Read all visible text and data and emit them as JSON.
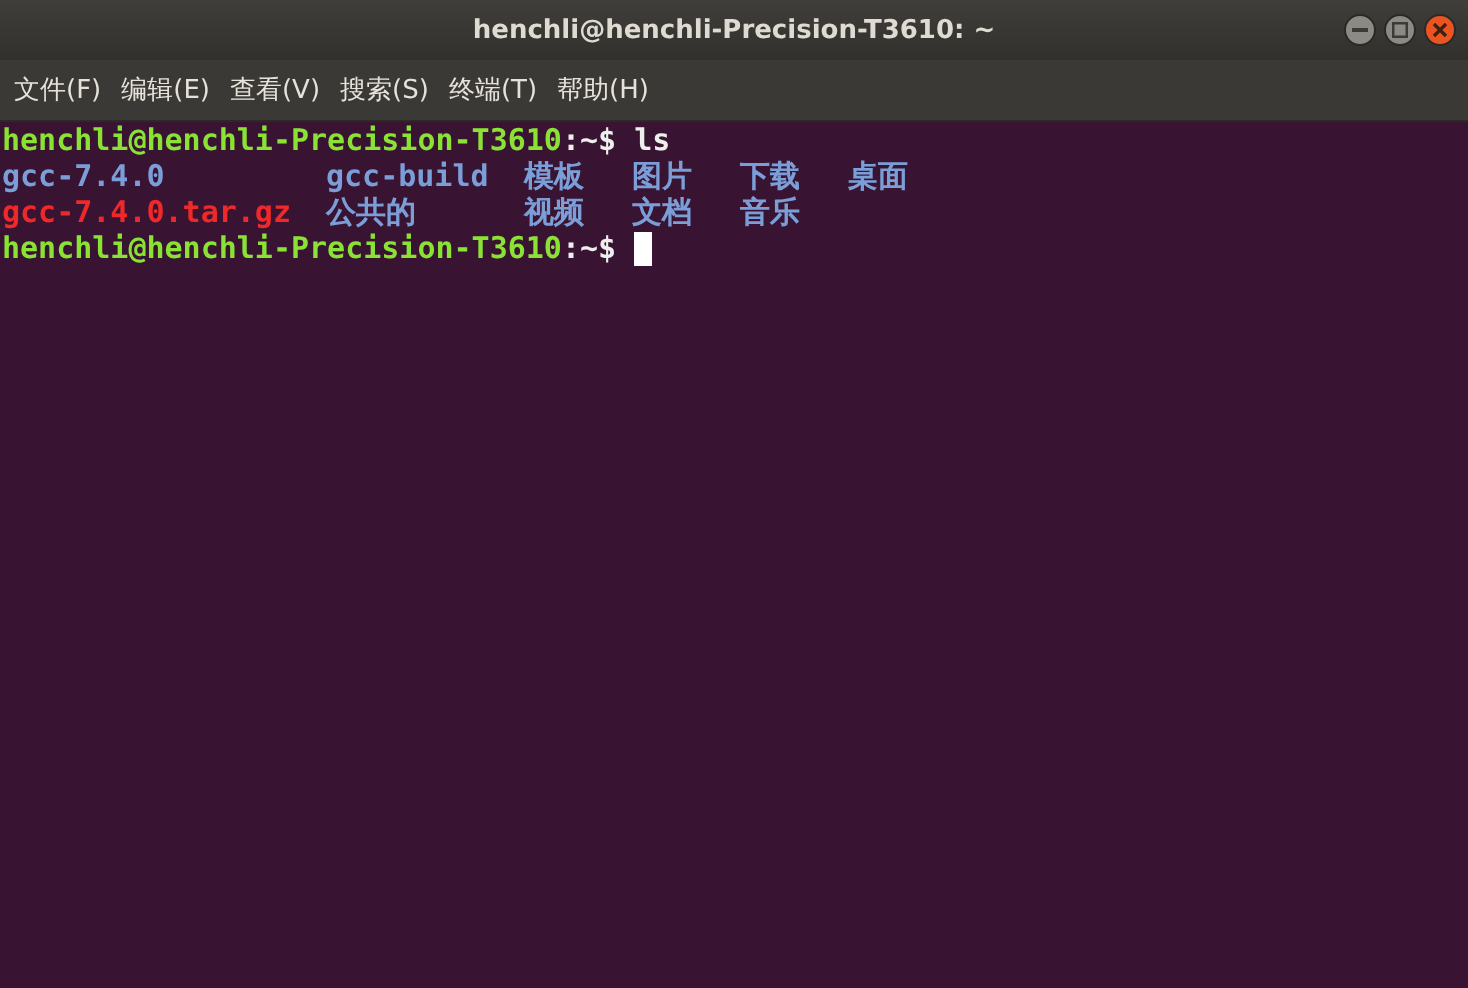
{
  "window": {
    "title": "henchli@henchli-Precision-T3610: ~"
  },
  "menu": [
    {
      "label": "文件(F)"
    },
    {
      "label": "编辑(E)"
    },
    {
      "label": "查看(V)"
    },
    {
      "label": "搜索(S)"
    },
    {
      "label": "终端(T)"
    },
    {
      "label": "帮助(H)"
    }
  ],
  "terminal": {
    "lines": [
      {
        "kind": "prompt",
        "prompt": "henchli@henchli-Precision-T3610",
        "path": ":~$",
        "command": "ls",
        "cursor": false
      },
      {
        "kind": "listing",
        "entries": [
          {
            "name": "gcc-7.4.0",
            "kind": "dir"
          },
          {
            "name": "gcc-build",
            "kind": "dir"
          },
          {
            "name": "模板",
            "kind": "dir"
          },
          {
            "name": "图片",
            "kind": "dir"
          },
          {
            "name": "下载",
            "kind": "dir"
          },
          {
            "name": "桌面",
            "kind": "dir"
          }
        ]
      },
      {
        "kind": "listing",
        "entries": [
          {
            "name": "gcc-7.4.0.tar.gz",
            "kind": "archive"
          },
          {
            "name": "公共的",
            "kind": "dir"
          },
          {
            "name": "视频",
            "kind": "dir"
          },
          {
            "name": "文档",
            "kind": "dir"
          },
          {
            "name": "音乐",
            "kind": "dir"
          }
        ]
      },
      {
        "kind": "prompt",
        "prompt": "henchli@henchli-Precision-T3610",
        "path": ":~$",
        "cursor": true
      }
    ]
  }
}
